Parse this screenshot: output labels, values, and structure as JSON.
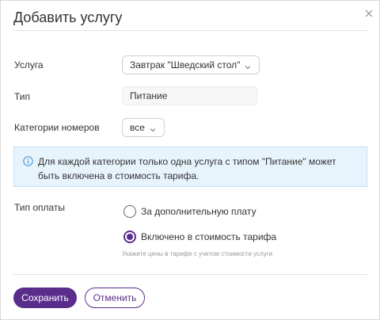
{
  "dialog": {
    "title": "Добавить услугу"
  },
  "form": {
    "service": {
      "label": "Услуга",
      "value": "Завтрак \"Шведский стол\""
    },
    "type": {
      "label": "Тип",
      "value": "Питание"
    },
    "room_categories": {
      "label": "Категории номеров",
      "value": "все"
    },
    "info_message": "Для каждой категории только одна услуга с типом \"Питание\" может быть включена в стоимость тарифа.",
    "payment_type": {
      "label": "Тип оплаты",
      "options": [
        {
          "label": "За дополнительную плату",
          "selected": false
        },
        {
          "label": "Включено в стоимость тарифа",
          "selected": true
        }
      ],
      "hint": "Укажите цены в тарифе с учетом стоимости услуги"
    }
  },
  "footer": {
    "save_label": "Сохранить",
    "cancel_label": "Отменить"
  },
  "icons": {
    "close": "close-icon",
    "info": "info-icon",
    "chevron": "chevron-down-icon"
  },
  "colors": {
    "accent": "#5a2d8c",
    "info_background": "#e8f4fc",
    "info_border": "#bfdff3",
    "info_icon": "#3a8fd1"
  }
}
